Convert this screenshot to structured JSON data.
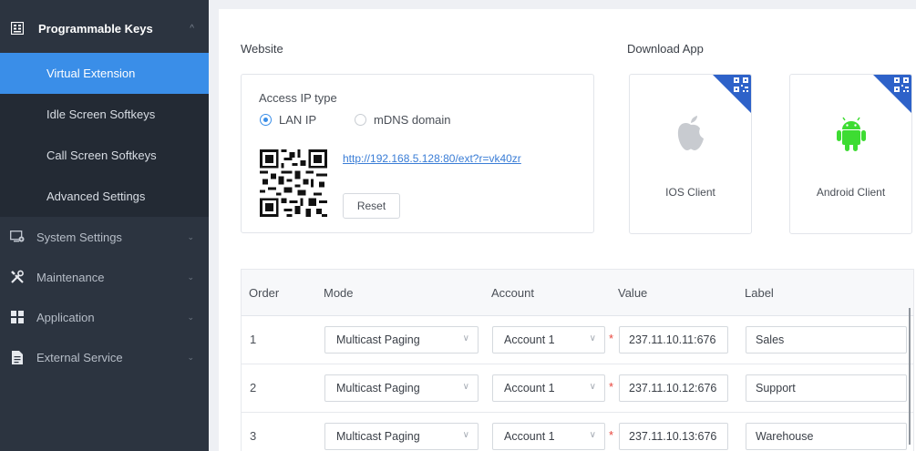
{
  "sidebar": {
    "group_open": {
      "label": "Programmable Keys",
      "icon": "keypad-icon"
    },
    "subitems": [
      {
        "label": "Virtual Extension",
        "active": true
      },
      {
        "label": "Idle Screen Softkeys",
        "active": false
      },
      {
        "label": "Call Screen Softkeys",
        "active": false
      },
      {
        "label": "Advanced Settings",
        "active": false
      }
    ],
    "items": [
      {
        "label": "System Settings",
        "icon": "monitor-gear-icon"
      },
      {
        "label": "Maintenance",
        "icon": "tools-icon"
      },
      {
        "label": "Application",
        "icon": "grid-icon"
      },
      {
        "label": "External Service",
        "icon": "document-icon"
      }
    ]
  },
  "website": {
    "title": "Website",
    "access_ip_type_label": "Access IP type",
    "options": [
      "LAN IP",
      "mDNS domain"
    ],
    "selected": "LAN IP",
    "url": "http://192.168.5.128:80/ext?r=vk40zr",
    "reset_label": "Reset"
  },
  "download": {
    "title": "Download App",
    "apps": [
      {
        "label": "IOS Client",
        "icon": "apple-icon"
      },
      {
        "label": "Android Client",
        "icon": "android-icon"
      }
    ]
  },
  "table": {
    "headers": [
      "Order",
      "Mode",
      "Account",
      "Value",
      "Label"
    ],
    "rows": [
      {
        "order": "1",
        "mode": "Multicast Paging",
        "account": "Account 1",
        "value": "237.11.10.11:676",
        "label": "Sales"
      },
      {
        "order": "2",
        "mode": "Multicast Paging",
        "account": "Account 1",
        "value": "237.11.10.12:676",
        "label": "Support"
      },
      {
        "order": "3",
        "mode": "Multicast Paging",
        "account": "Account 1",
        "value": "237.11.10.13:676",
        "label": "Warehouse"
      }
    ]
  },
  "colors": {
    "accent": "#3a8ee8",
    "sidebar_bg": "#2c3440",
    "required": "#e8453c",
    "android": "#3ddc32",
    "apple": "#c8cbd0"
  }
}
